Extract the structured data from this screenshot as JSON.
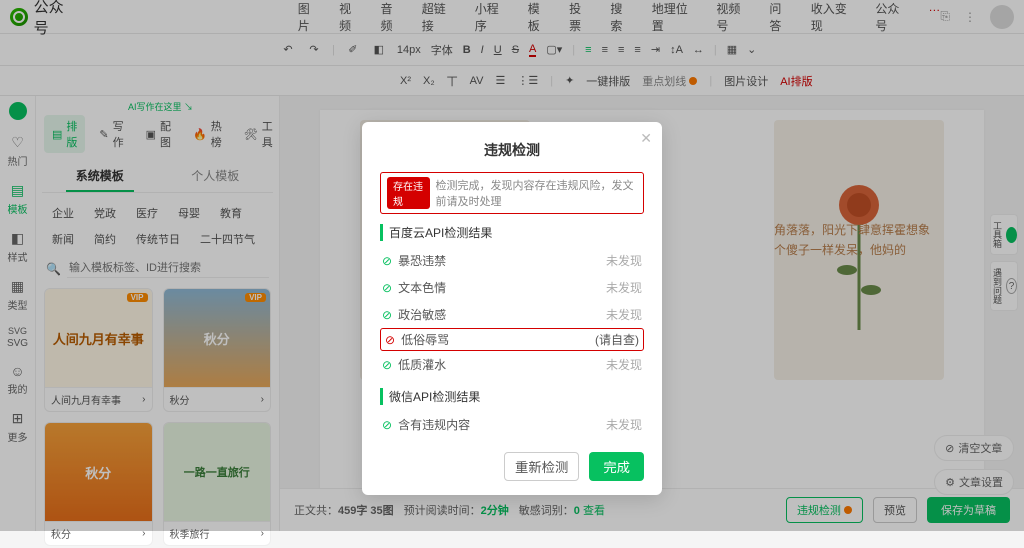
{
  "header": {
    "app_name": "公众号",
    "menu": [
      "图片",
      "视频",
      "音频",
      "超链接",
      "小程序",
      "模板",
      "投票",
      "搜索",
      "地理位置",
      "视频号",
      "问答",
      "收入变现",
      "公众号"
    ]
  },
  "toolbar": {
    "undo": "↶",
    "redo": "↷",
    "font_size": "14px",
    "font_family": "字体",
    "bold": "B",
    "italic": "I",
    "underline": "U",
    "strike": "S",
    "fontA": "A",
    "row2_x2": "X²",
    "row2_x2b": "X₂",
    "one_key_typeset": "一键排版",
    "focus_select": "重点划线",
    "img_design": "图片设计",
    "ai_typeset": "AI排版"
  },
  "tabbar": {
    "ai_hint": "AI写作在这里",
    "items": [
      {
        "icon": "▤",
        "label": "排版"
      },
      {
        "icon": "✎",
        "label": "写作"
      },
      {
        "icon": "▣",
        "label": "配图"
      },
      {
        "icon": "🔥",
        "label": "热榜"
      },
      {
        "icon": "🛠",
        "label": "工具"
      }
    ]
  },
  "rail": {
    "items": [
      {
        "icon": "♡",
        "label": "热门"
      },
      {
        "icon": "▤",
        "label": "模板"
      },
      {
        "icon": "◧",
        "label": "样式"
      },
      {
        "icon": "▦",
        "label": "类型"
      },
      {
        "icon": "SVG",
        "label": "SVG"
      },
      {
        "icon": "☺",
        "label": "我的"
      },
      {
        "icon": "⋮⋮",
        "label": "更多"
      }
    ]
  },
  "subtabs": {
    "system": "系统模板",
    "personal": "个人模板"
  },
  "tags_row1": [
    "企业",
    "党政",
    "医疗",
    "母婴",
    "教育"
  ],
  "tags_row2": [
    "新闻",
    "简约",
    "传统节日",
    "二十四节气"
  ],
  "search": {
    "placeholder": "输入模板标签、ID进行搜索",
    "icon": "🔍"
  },
  "cards": [
    {
      "title": "人间九月有幸事",
      "caption": "人间九月有幸事",
      "bg": "#fff7e6",
      "accent": "#b85c00",
      "vip": "VIP"
    },
    {
      "title": "秋分",
      "caption": "秋分",
      "bg": "#8fb9d6",
      "accent": "#fff",
      "vip": "VIP"
    },
    {
      "title": "秋分",
      "caption": "秋分",
      "bg": "#f6a13a",
      "accent": "#fff",
      "vip": ""
    },
    {
      "title": "一路一直旅行",
      "caption": "秋季旅行",
      "bg": "#e7f4e0",
      "accent": "#3a7e3a",
      "vip": ""
    }
  ],
  "editor": {
    "text1": "角落落，阳光下肆意挥霍想象",
    "text2": "个傻子一样发呆，他妈的"
  },
  "footer": {
    "body_stat_label": "正文共：",
    "body_stat_value": "459字 35图",
    "read_label": "预计阅读时间：",
    "read_value": "2分钟",
    "sensitive_label": "敏感词别：",
    "sensitive_value": "0",
    "view": "查看",
    "violation_check": "违规检测",
    "preview": "预览",
    "save_draft": "保存为草稿",
    "clear_article": "清空文章",
    "article_settings": "文章设置"
  },
  "right_float": {
    "toolbox": "工具箱",
    "feedback": "遇到问题"
  },
  "modal": {
    "title": "违规检测",
    "banner_tag": "存在违规",
    "banner_text": "检测完成，发现内容存在违规风险，发文前请及时处理",
    "section1": "百度云API检测结果",
    "rows1": [
      {
        "icon": "ok",
        "label": "暴恐违禁",
        "status": "未发现"
      },
      {
        "icon": "ok",
        "label": "文本色情",
        "status": "未发现"
      },
      {
        "icon": "ok",
        "label": "政治敏感",
        "status": "未发现"
      },
      {
        "icon": "warn",
        "label": "低俗辱骂",
        "status": "(请自查)",
        "highlight": true
      },
      {
        "icon": "ok",
        "label": "低质灌水",
        "status": "未发现"
      }
    ],
    "section2": "微信API检测结果",
    "rows2": [
      {
        "icon": "ok",
        "label": "含有违规内容",
        "status": "未发现"
      }
    ],
    "recheck": "重新检测",
    "done": "完成"
  }
}
